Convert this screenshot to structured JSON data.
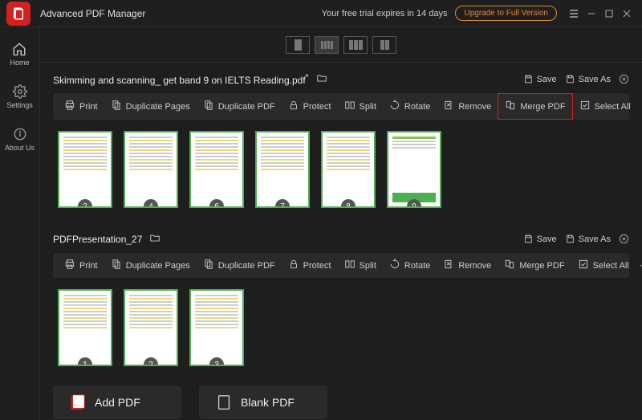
{
  "titlebar": {
    "app_name": "Advanced PDF Manager",
    "trial_text": "Your free trial expires in 14 days",
    "upgrade_label": "Upgrade to Full Version"
  },
  "sidebar": {
    "home": "Home",
    "settings": "Settings",
    "about": "About Us"
  },
  "toolbar_labels": {
    "print": "Print",
    "duplicate_pages": "Duplicate Pages",
    "duplicate_pdf": "Duplicate PDF",
    "protect": "Protect",
    "split": "Split",
    "rotate": "Rotate",
    "remove": "Remove",
    "merge": "Merge PDF",
    "select_all": "Select All"
  },
  "head_labels": {
    "save": "Save",
    "save_as": "Save As"
  },
  "documents": [
    {
      "name": "Skimming and scanning_ get band 9 on IELTS Reading.pdf",
      "modified": "*",
      "pages": [
        2,
        4,
        6,
        7,
        8,
        9
      ]
    },
    {
      "name": "PDFPresentation_27",
      "pages": [
        1,
        2,
        3
      ]
    }
  ],
  "actions": {
    "add_pdf": "Add PDF",
    "blank_pdf": "Blank PDF"
  }
}
